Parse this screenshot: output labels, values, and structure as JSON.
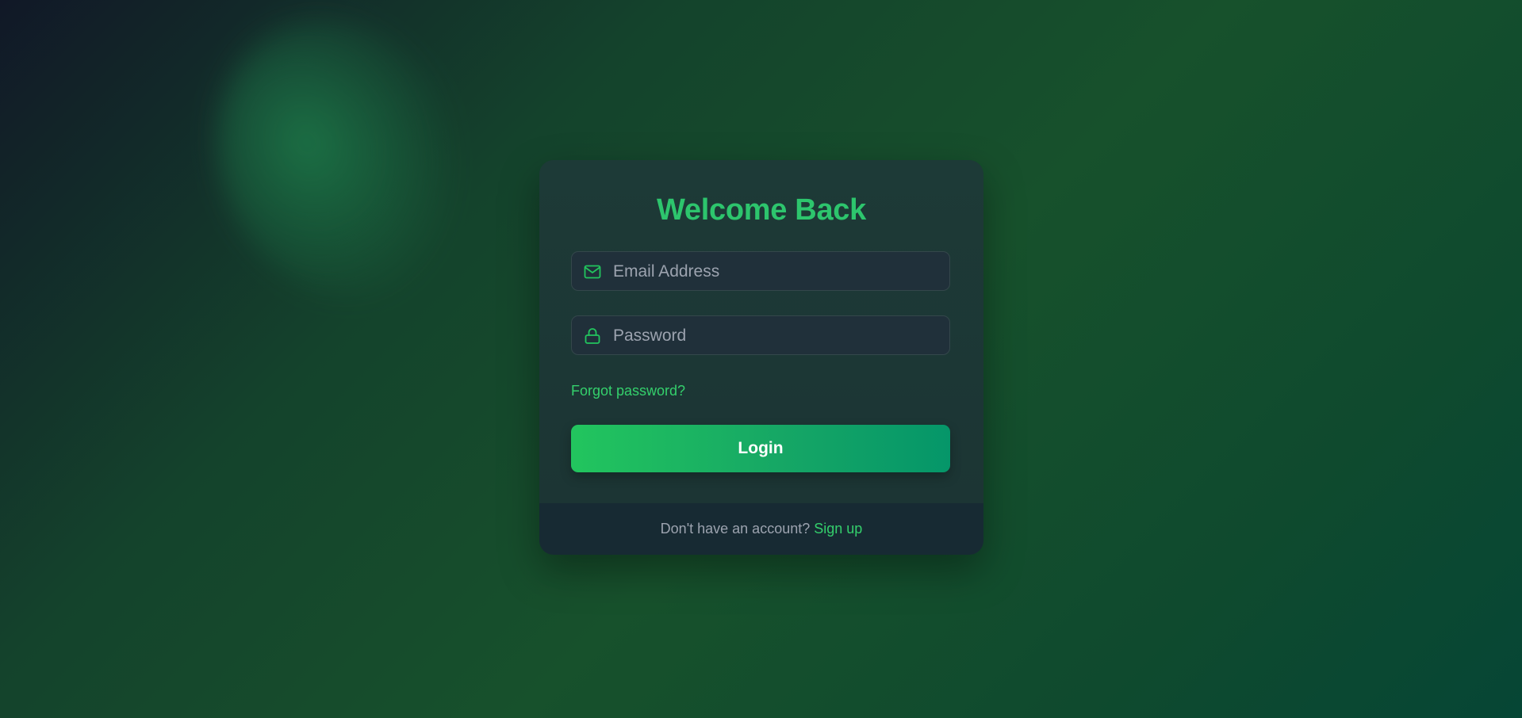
{
  "login": {
    "title": "Welcome Back",
    "email": {
      "placeholder": "Email Address",
      "value": "",
      "icon": "mail-icon"
    },
    "password": {
      "placeholder": "Password",
      "value": "",
      "icon": "lock-icon"
    },
    "forgot_label": "Forgot password?",
    "button_label": "Login",
    "footer_text": "Don't have an account?",
    "signup_label": "Sign up"
  },
  "colors": {
    "accent": "#22c55e",
    "title": "#2dc56d",
    "link": "#34d06c",
    "card": "#1c3b37",
    "footer": "#172a33"
  }
}
